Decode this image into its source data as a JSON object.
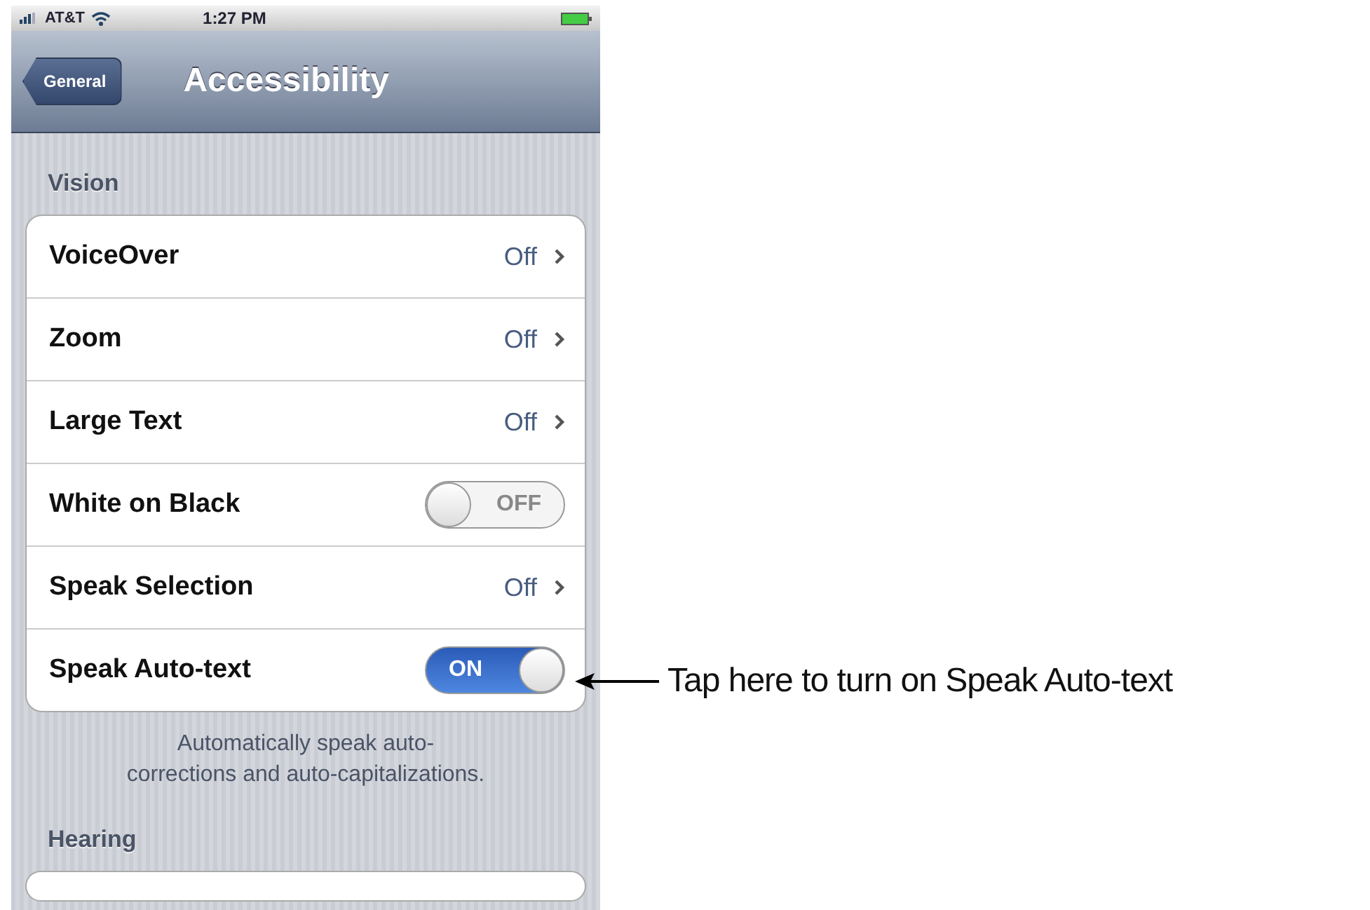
{
  "status_bar": {
    "carrier": "AT&T",
    "time": "1:27 PM"
  },
  "nav_bar": {
    "back": "General",
    "title": "Accessibility"
  },
  "sections": [
    {
      "header": "Vision",
      "rows": [
        {
          "kind": "disclosure",
          "label": "VoiceOver",
          "value": "Off"
        },
        {
          "kind": "disclosure",
          "label": "Zoom",
          "value": "Off"
        },
        {
          "kind": "disclosure",
          "label": "Large Text",
          "value": "Off"
        },
        {
          "kind": "toggle",
          "label": "White on Black",
          "on": false,
          "switch_text": "OFF"
        },
        {
          "kind": "disclosure",
          "label": "Speak Selection",
          "value": "Off"
        },
        {
          "kind": "toggle",
          "label": "Speak Auto-text",
          "on": true,
          "switch_text": "ON"
        }
      ],
      "footer": "Automatically speak auto-corrections and auto-capitalizations."
    },
    {
      "header": "Hearing"
    }
  ],
  "callout": "Tap here to turn on Speak Auto-text"
}
